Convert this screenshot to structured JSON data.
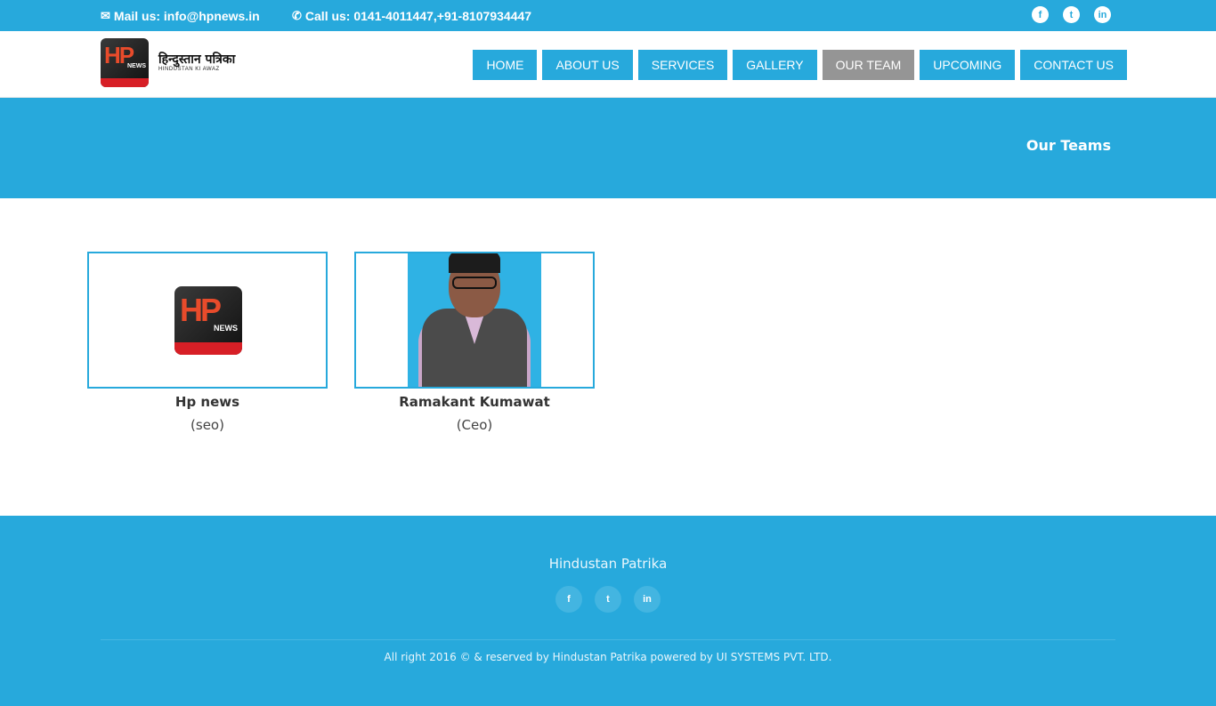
{
  "topbar": {
    "mail_text": "Mail us: info@hpnews.in",
    "call_text": "Call us: 0141-4011447,+91-8107934447",
    "mail_icon": "envelope-icon",
    "call_icon": "phone-icon",
    "social": [
      {
        "name": "facebook",
        "glyph": "f"
      },
      {
        "name": "twitter",
        "glyph": "t"
      },
      {
        "name": "linkedin",
        "glyph": "in"
      }
    ]
  },
  "header": {
    "logo": {
      "badge_text": "HP",
      "badge_sub": "NEWS",
      "hindi": "हिन्दुस्तान पत्रिका",
      "sub": "HINDUSTAN KI AWAZ"
    },
    "nav": [
      {
        "label": "HOME",
        "active": false
      },
      {
        "label": "ABOUT US",
        "active": false
      },
      {
        "label": "SERVICES",
        "active": false
      },
      {
        "label": "GALLERY",
        "active": false
      },
      {
        "label": "OUR TEAM",
        "active": true
      },
      {
        "label": "UPCOMING",
        "active": false
      },
      {
        "label": "CONTACT US",
        "active": false
      }
    ]
  },
  "banner": {
    "title": "Our Teams"
  },
  "team": [
    {
      "name": "Hp news",
      "role": "(seo)",
      "image": "hp-news-logo"
    },
    {
      "name": "Ramakant Kumawat",
      "role": "(Ceo)",
      "image": "person-photo"
    }
  ],
  "footer": {
    "brand": "Hindustan Patrika",
    "social": [
      {
        "name": "facebook",
        "glyph": "f"
      },
      {
        "name": "twitter",
        "glyph": "t"
      },
      {
        "name": "linkedin",
        "glyph": "in"
      }
    ],
    "copyright": "All right 2016 © & reserved by Hindustan Patrika powered by UI SYSTEMS PVT. LTD."
  },
  "colors": {
    "primary": "#27a9dc",
    "active_nav": "#959595",
    "white": "#ffffff"
  }
}
